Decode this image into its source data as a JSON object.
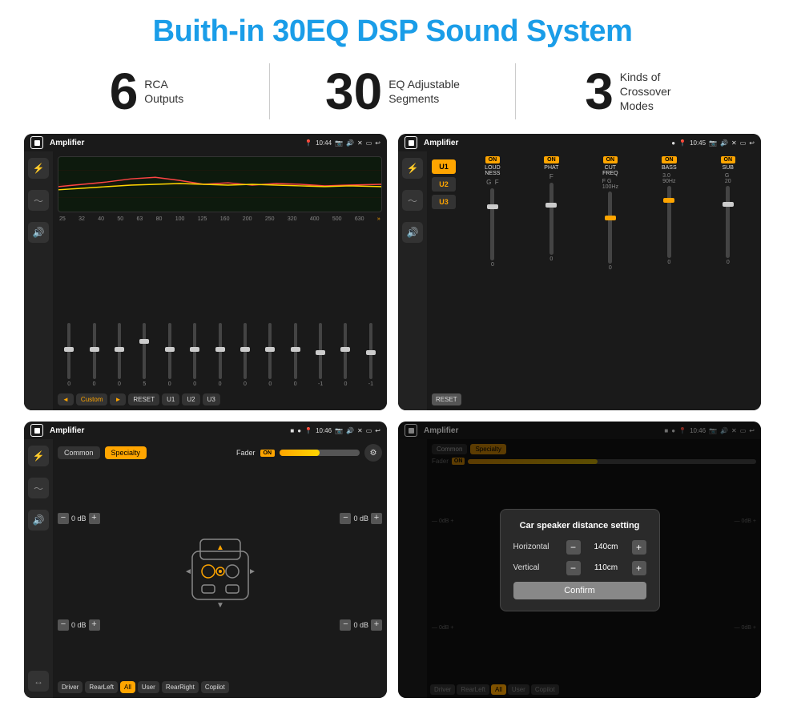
{
  "title": "Buith-in 30EQ DSP Sound System",
  "stats": [
    {
      "number": "6",
      "label": "RCA\nOutputs"
    },
    {
      "number": "30",
      "label": "EQ Adjustable\nSegments"
    },
    {
      "number": "3",
      "label": "Kinds of\nCrossover Modes"
    }
  ],
  "screens": [
    {
      "id": "screen1",
      "status_bar": {
        "time": "10:44",
        "title": "Amplifier"
      },
      "type": "eq"
    },
    {
      "id": "screen2",
      "status_bar": {
        "time": "10:45",
        "title": "Amplifier"
      },
      "type": "amp"
    },
    {
      "id": "screen3",
      "status_bar": {
        "time": "10:46",
        "title": "Amplifier"
      },
      "type": "speaker"
    },
    {
      "id": "screen4",
      "status_bar": {
        "time": "10:46",
        "title": "Amplifier"
      },
      "type": "dialog",
      "dialog": {
        "title": "Car speaker distance setting",
        "horizontal_label": "Horizontal",
        "horizontal_value": "140cm",
        "vertical_label": "Vertical",
        "vertical_value": "110cm",
        "confirm_label": "Confirm"
      }
    }
  ],
  "eq_freqs": [
    "25",
    "32",
    "40",
    "50",
    "63",
    "80",
    "100",
    "125",
    "160",
    "200",
    "250",
    "320",
    "400",
    "500",
    "630"
  ],
  "eq_vals": [
    "0",
    "0",
    "0",
    "5",
    "0",
    "0",
    "0",
    "0",
    "0",
    "0",
    "-1",
    "0",
    "-1"
  ],
  "eq_presets": [
    "Custom",
    "RESET",
    "U1",
    "U2",
    "U3"
  ],
  "amp_presets": [
    "U1",
    "U2",
    "U3"
  ],
  "amp_channels": [
    "LOUDNESS",
    "PHAT",
    "CUT FREQ",
    "BASS",
    "SUB"
  ],
  "speaker_tabs": [
    "Common",
    "Specialty"
  ],
  "speaker_bottom": [
    "Driver",
    "RearLeft",
    "All",
    "User",
    "RearRight",
    "Copilot"
  ]
}
